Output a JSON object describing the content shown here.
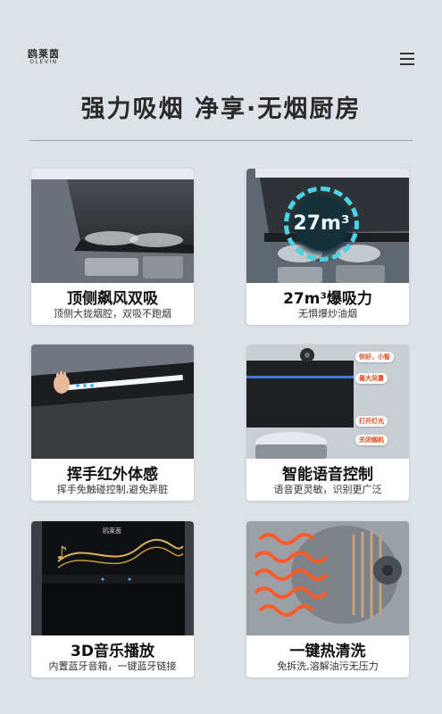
{
  "brand": {
    "name_cn": "鸥莱茵",
    "name_en": "OLEVIN",
    "tagline": "· · · · ·"
  },
  "headline": "强力吸烟  净享·无烟厨房",
  "features": [
    {
      "title": "顶侧飙风双吸",
      "subtitle": "顶侧大拢烟腔，双吸不跑烟"
    },
    {
      "title": "27m³爆吸力",
      "subtitle": "无惧爆炒油烟",
      "badge": "27m³"
    },
    {
      "title": "挥手红外体感",
      "subtitle": "挥手免触碰控制,避免弄脏"
    },
    {
      "title": "智能语音控制",
      "subtitle": "语音更灵敏，识别更广泛",
      "voice_chips": [
        "你好，小智",
        "最大风量",
        "打开灯光",
        "关闭烟机"
      ]
    },
    {
      "title": "3D音乐播放",
      "subtitle": "内置蓝牙音箱，一键蓝牙链接",
      "device_logo": "鸥莱茵"
    },
    {
      "title": "一键热清洗",
      "subtitle": "免拆洗,溶解油污无压力"
    }
  ]
}
